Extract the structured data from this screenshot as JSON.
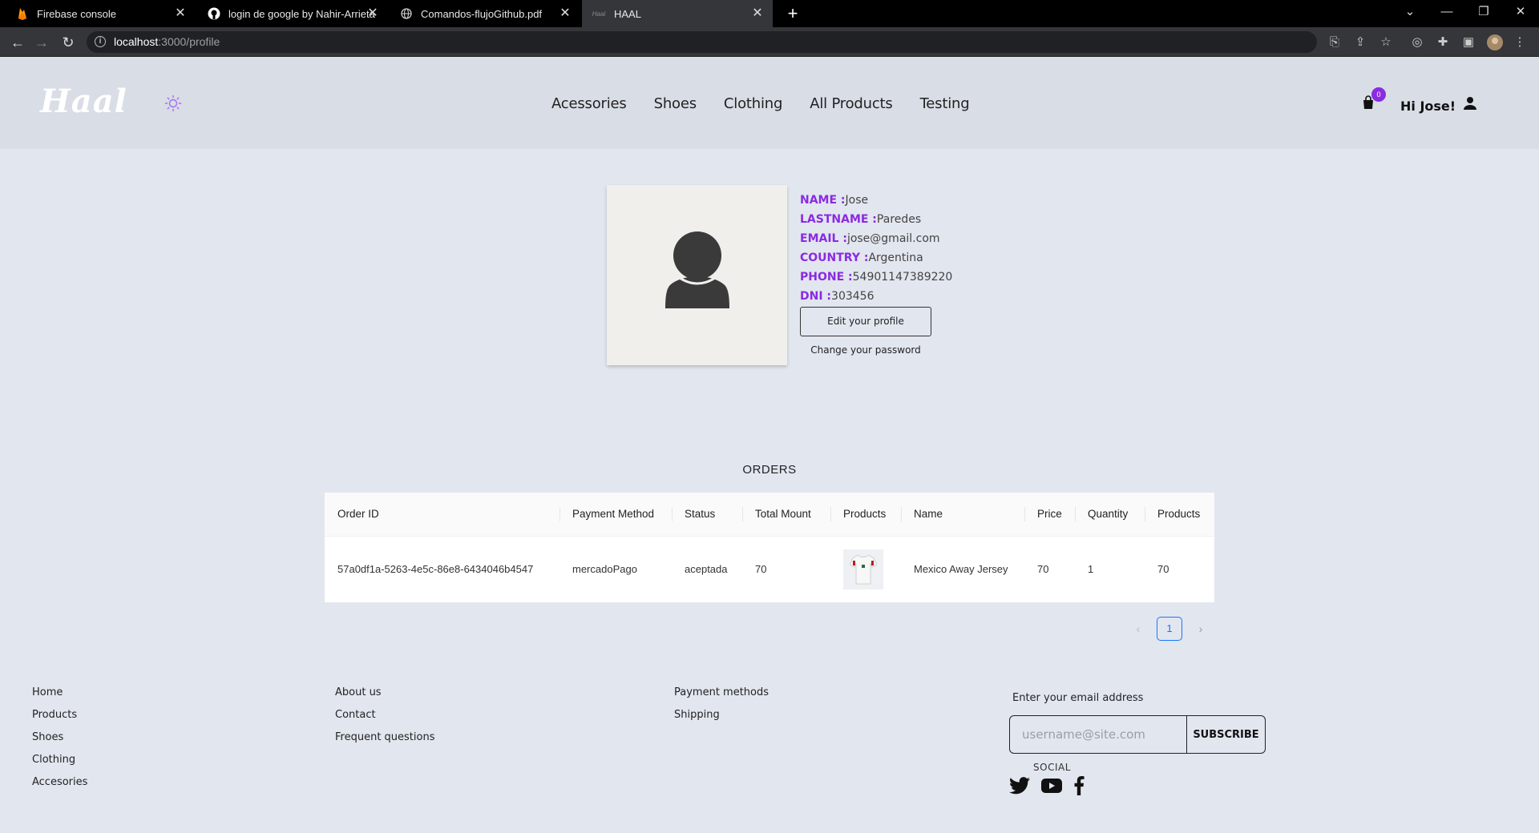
{
  "browser": {
    "tabs": [
      {
        "title": "Firebase console",
        "icon": "firebase-icon"
      },
      {
        "title": "login de google by Nahir-Arrieta",
        "icon": "github-icon"
      },
      {
        "title": "Comandos-flujoGithub.pdf",
        "icon": "globe-icon"
      },
      {
        "title": "HAAL",
        "icon": "haal-favicon"
      }
    ],
    "url_host": "localhost",
    "url_path": ":3000/profile"
  },
  "header": {
    "logo": "Haal",
    "nav": [
      "Acessories",
      "Shoes",
      "Clothing",
      "All Products",
      "Testing"
    ],
    "cart_count": "0",
    "greeting": "Hi Jose!"
  },
  "profile": {
    "name_label": "NAME :",
    "name": "Jose",
    "lastname_label": "LASTNAME :",
    "lastname": "Paredes",
    "email_label": "EMAIL :",
    "email": "jose@gmail.com",
    "country_label": "COUNTRY :",
    "country": "Argentina",
    "phone_label": "PHONE :",
    "phone": "54901147389220",
    "dni_label": "DNI :",
    "dni": "303456",
    "edit_button": "Edit your profile",
    "change_password": "Change your password"
  },
  "orders": {
    "title": "ORDERS",
    "columns": [
      "Order ID",
      "Payment Method",
      "Status",
      "Total Mount",
      "Products",
      "Name",
      "Price",
      "Quantity",
      "Products"
    ],
    "rows": [
      {
        "order_id": "57a0df1a-5263-4e5c-86e8-6434046b4547",
        "payment_method": "mercadoPago",
        "status": "aceptada",
        "total": "70",
        "name": "Mexico Away Jersey",
        "price": "70",
        "quantity": "1",
        "products": "70"
      }
    ],
    "page": "1"
  },
  "footer": {
    "col1": [
      "Home",
      "Products",
      "Shoes",
      "Clothing",
      "Accesories"
    ],
    "col2": [
      "About us",
      "Contact",
      "Frequent questions"
    ],
    "col3": [
      "Payment methods",
      "Shipping"
    ],
    "subscribe_label": "Enter your email address",
    "subscribe_placeholder": "username@site.com",
    "subscribe_button": "SUBSCRIBE",
    "social_label": "SOCIAL"
  },
  "colors": {
    "accent": "#8a2be2",
    "page_bg": "#e2e6ef",
    "header_bg": "#d9dde6",
    "pager": "#1677ff"
  }
}
